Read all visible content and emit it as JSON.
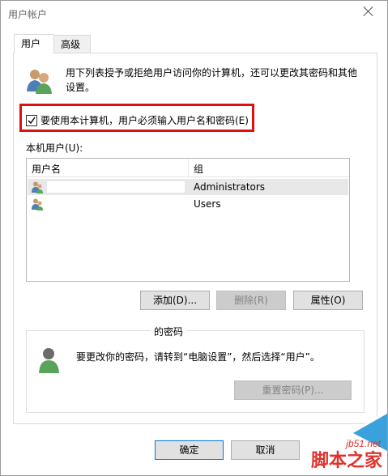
{
  "window": {
    "title": "用户帐户"
  },
  "tabs": [
    {
      "label": "用户"
    },
    {
      "label": "高级"
    }
  ],
  "description": "用下列表授予或拒绝用户访问你的计算机，还可以更改其密码和其他设置。",
  "require_login": {
    "label": "要使用本计算机，用户必须输入用户名和密码(E)",
    "checked": true
  },
  "local_users": {
    "label": "本机用户(U):",
    "columns": [
      "用户名",
      "组"
    ],
    "rows": [
      {
        "name": "",
        "group": "Administrators",
        "selected": true
      },
      {
        "name": "",
        "group": "Users",
        "selected": false
      }
    ]
  },
  "buttons": {
    "add": "添加(D)...",
    "remove": "删除(R)",
    "properties": "属性(O)"
  },
  "password": {
    "group_title": "的密码",
    "description": "要更改你的密码，请转到“电脑设置”，然后选择“用户”。",
    "reset_button": "重置密码(P)..."
  },
  "footer": {
    "ok": "确定",
    "cancel": "取消"
  },
  "watermark": {
    "site": "jb51.net",
    "name": "脚本之家"
  },
  "colors": {
    "highlight": "#e01010",
    "selection": "#e8e8e8",
    "accent": "#0078d7"
  }
}
